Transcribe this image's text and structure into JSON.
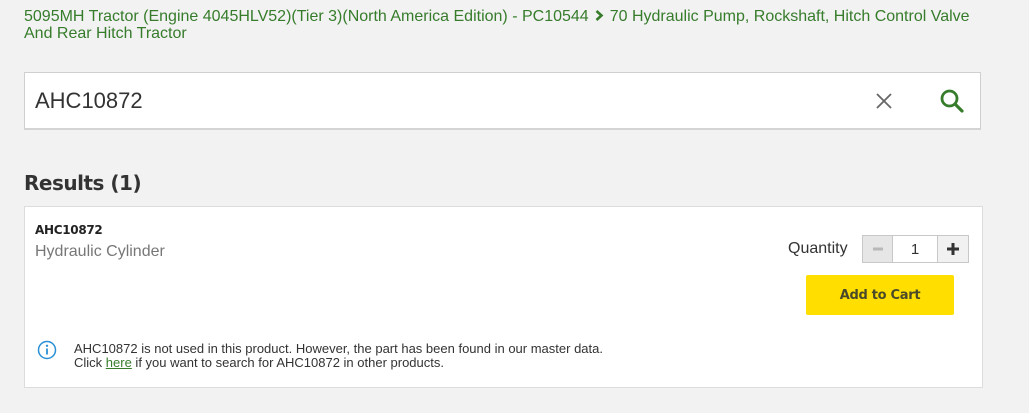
{
  "breadcrumb": {
    "product": "5095MH Tractor (Engine 4045HLV52)(Tier 3)(North America Edition) - PC10544",
    "section": "70 Hydraulic Pump, Rockshaft, Hitch Control Valve And Rear Hitch Tractor"
  },
  "search": {
    "value": "AHC10872",
    "clear_icon": "close-icon",
    "search_icon": "magnifier-icon"
  },
  "results": {
    "title": "Results (1)",
    "items": [
      {
        "part_number": "AHC10872",
        "name": "Hydraulic Cylinder",
        "quantity_label": "Quantity",
        "quantity": "1",
        "add_to_cart": "Add to Cart"
      }
    ]
  },
  "notice": {
    "icon": "info-icon",
    "line1": "AHC10872 is not used in this product. However, the part has been found in our master data.",
    "line2_prefix": "Click ",
    "link": "here",
    "line2_suffix": " if you want to search for AHC10872 in other products."
  },
  "colors": {
    "brand_green": "#367c2b",
    "cart_yellow": "#ffde00",
    "background": "#f2f2f2",
    "info_blue": "#2b8fd6"
  }
}
